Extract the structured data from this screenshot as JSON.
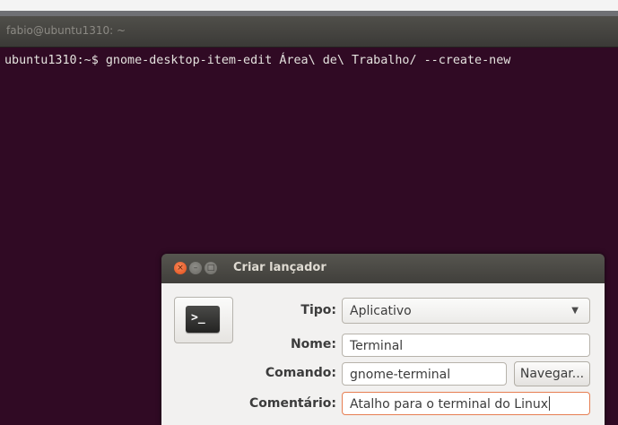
{
  "terminal": {
    "title": "fabio@ubuntu1310: ~",
    "command_line": "ubuntu1310:~$ gnome-desktop-item-edit Área\\ de\\ Trabalho/ --create-new"
  },
  "dialog": {
    "title": "Criar lançador",
    "window_buttons": {
      "close": "×",
      "minimize": "–",
      "maximize": "□"
    },
    "icon_glyph": ">_",
    "fields": {
      "tipo": {
        "label": "Tipo:",
        "value": "Aplicativo"
      },
      "nome": {
        "label": "Nome:",
        "value": "Terminal"
      },
      "comando": {
        "label": "Comando:",
        "value": "gnome-terminal",
        "browse_label": "Navegar..."
      },
      "comentario": {
        "label": "Comentário:",
        "value": "Atalho para o terminal do Linux"
      }
    }
  },
  "colors": {
    "terminal_bg": "#300a24",
    "dialog_bg": "#f2f1f0",
    "close_button": "#df4a16",
    "focus_border": "#e67e52"
  },
  "icons": {
    "close": "close-icon",
    "minimize": "minimize-icon",
    "maximize": "maximize-icon",
    "launcher": "terminal-icon",
    "dropdown": "chevron-down-icon"
  }
}
